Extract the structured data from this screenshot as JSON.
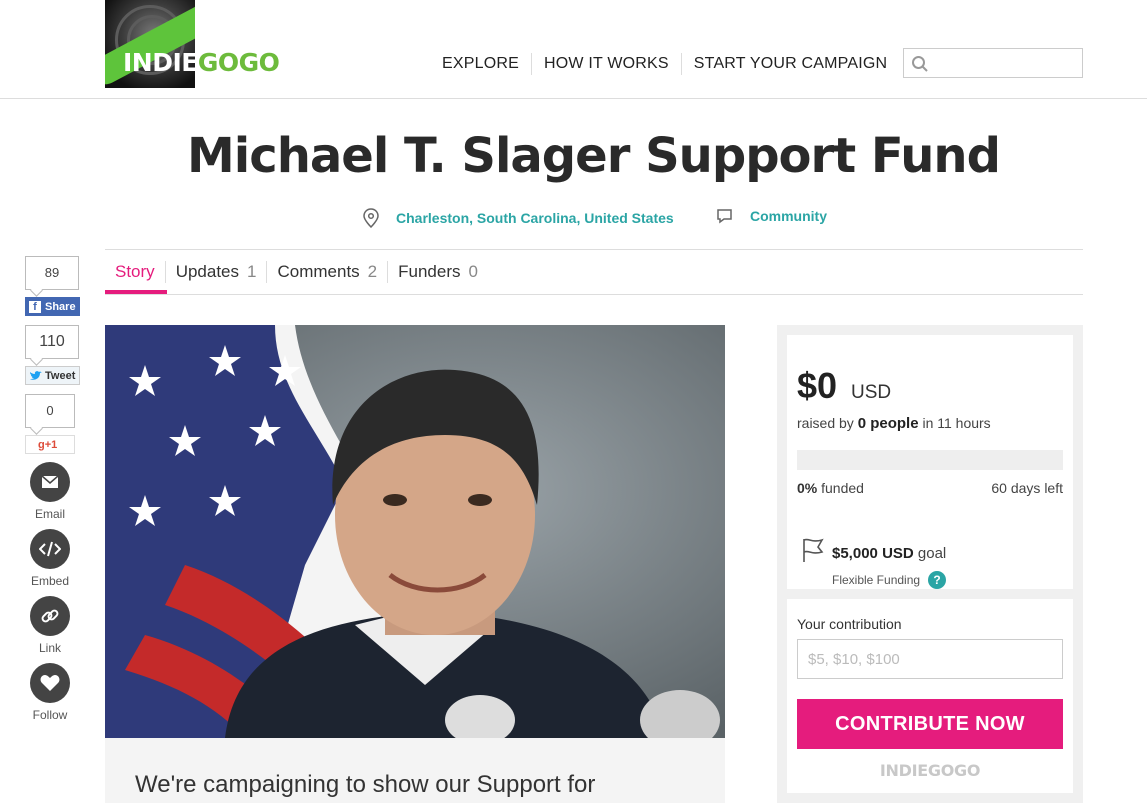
{
  "brand": {
    "logo_white": "INDIE",
    "logo_green": "GOGO",
    "accent": "#e51c7d",
    "teal": "#2ba5a5",
    "green": "#6dbb3c"
  },
  "nav": {
    "items": [
      "EXPLORE",
      "HOW IT WORKS",
      "START YOUR CAMPAIGN"
    ],
    "search_placeholder": ""
  },
  "campaign": {
    "title": "Michael T. Slager Support Fund",
    "location": "Charleston, South Carolina, United States",
    "category": "Community"
  },
  "tabs": [
    {
      "label": "Story",
      "count": ""
    },
    {
      "label": "Updates",
      "count": "1"
    },
    {
      "label": "Comments",
      "count": "2"
    },
    {
      "label": "Funders",
      "count": "0"
    }
  ],
  "share": {
    "facebook_count": "89",
    "facebook_label": "Share",
    "twitter_count": "110",
    "twitter_label": "Tweet",
    "gplus_count": "0",
    "gplus_label": "+1",
    "email_label": "Email",
    "embed_label": "Embed",
    "link_label": "Link",
    "follow_label": "Follow"
  },
  "story": {
    "intro": "We're campaigning to show our Support for"
  },
  "funding": {
    "amount": "$0",
    "currency": "USD",
    "raised_prefix": "raised by",
    "people": "0 people",
    "time": "in 11 hours",
    "percent_funded": 0,
    "funded_value": "0%",
    "funded_label": "funded",
    "days_left": "60 days left",
    "goal_amount": "$5,000",
    "goal_currency": "USD",
    "goal_label": "goal",
    "funding_type": "Flexible Funding"
  },
  "contribute": {
    "label": "Your contribution",
    "placeholder": "$5, $10, $100",
    "button": "CONTRIBUTE NOW",
    "footer_logo": "INDIEGOGO"
  }
}
